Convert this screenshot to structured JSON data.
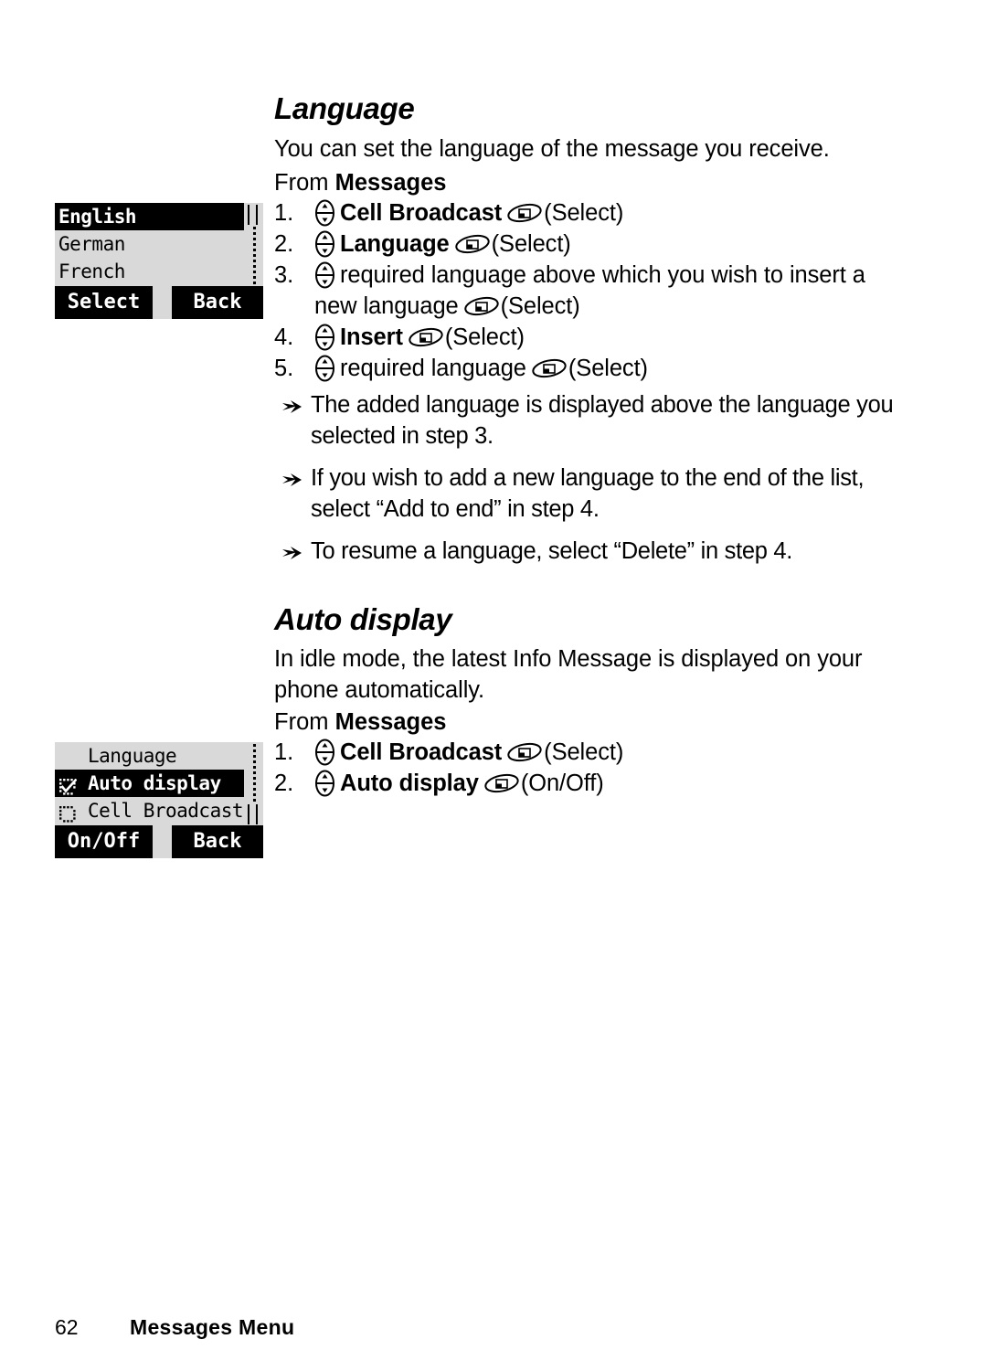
{
  "sections": [
    {
      "id": "language",
      "heading": "Language",
      "intro": "You can set the language of the message you receive.",
      "from_prefix": "From ",
      "from_menu": "Messages",
      "steps": [
        {
          "num": "1.",
          "icon": "nav-key-icon",
          "label": "Cell Broadcast",
          "bold": true,
          "key_icon": "soft-key-icon",
          "action": "(Select)"
        },
        {
          "num": "2.",
          "icon": "nav-key-icon",
          "label": "Language",
          "bold": true,
          "key_icon": "soft-key-icon",
          "action": "(Select)"
        },
        {
          "num": "3.",
          "icon": "nav-key-icon",
          "label": "required language above which you wish to insert a new language",
          "bold": false,
          "key_icon": "soft-key-icon",
          "action": "(Select)"
        },
        {
          "num": "4.",
          "icon": "nav-key-icon",
          "label": "Insert",
          "bold": true,
          "key_icon": "soft-key-icon",
          "action": "(Select)"
        },
        {
          "num": "5.",
          "icon": "nav-key-icon",
          "label": "required language",
          "bold": false,
          "key_icon": "soft-key-icon",
          "action": "(Select)"
        }
      ],
      "notes": [
        "The added language is displayed above the language you selected in step 3.",
        "If you wish to add a new language to the end of the list, select “Add to end” in step 4.",
        "To resume a language, select “Delete” in step 4."
      ]
    },
    {
      "id": "autodisplay",
      "heading": "Auto display",
      "intro": "In idle mode, the latest Info Message is displayed on your phone automatically.",
      "from_prefix": "From ",
      "from_menu": "Messages",
      "steps": [
        {
          "num": "1.",
          "icon": "nav-key-icon",
          "label": "Cell Broadcast",
          "bold": true,
          "key_icon": "soft-key-icon",
          "action": "(Select)"
        },
        {
          "num": "2.",
          "icon": "nav-key-icon",
          "label": "Auto display",
          "bold": true,
          "key_icon": "soft-key-icon",
          "action": "(On/Off)"
        }
      ],
      "notes": []
    }
  ],
  "lcd_screens": [
    {
      "id": "language-list",
      "rows": [
        {
          "text": "English",
          "selected": true,
          "checkbox": "none",
          "indent": false
        },
        {
          "text": "German",
          "selected": false,
          "checkbox": "none",
          "indent": false
        },
        {
          "text": "French",
          "selected": false,
          "checkbox": "none",
          "indent": false
        }
      ],
      "scroll_thumb": "top",
      "softkey_left": "Select",
      "softkey_right": "Back"
    },
    {
      "id": "cell-broadcast-options",
      "rows": [
        {
          "text": "Language",
          "selected": false,
          "checkbox": "none",
          "indent": true
        },
        {
          "text": "Auto display",
          "selected": true,
          "checkbox": "checked",
          "indent": false
        },
        {
          "text": "Cell Broadcast",
          "selected": false,
          "checkbox": "unchecked",
          "indent": false
        }
      ],
      "scroll_thumb": "bottom",
      "softkey_left": "On/Off",
      "softkey_right": "Back"
    }
  ],
  "footer": {
    "page_number": "62",
    "title": "Messages Menu"
  },
  "colors": {
    "lcd_background": "#d9d9d9",
    "lcd_highlight": "#000000",
    "lcd_text": "#000000",
    "page_background": "#ffffff",
    "ink": "#000000"
  }
}
